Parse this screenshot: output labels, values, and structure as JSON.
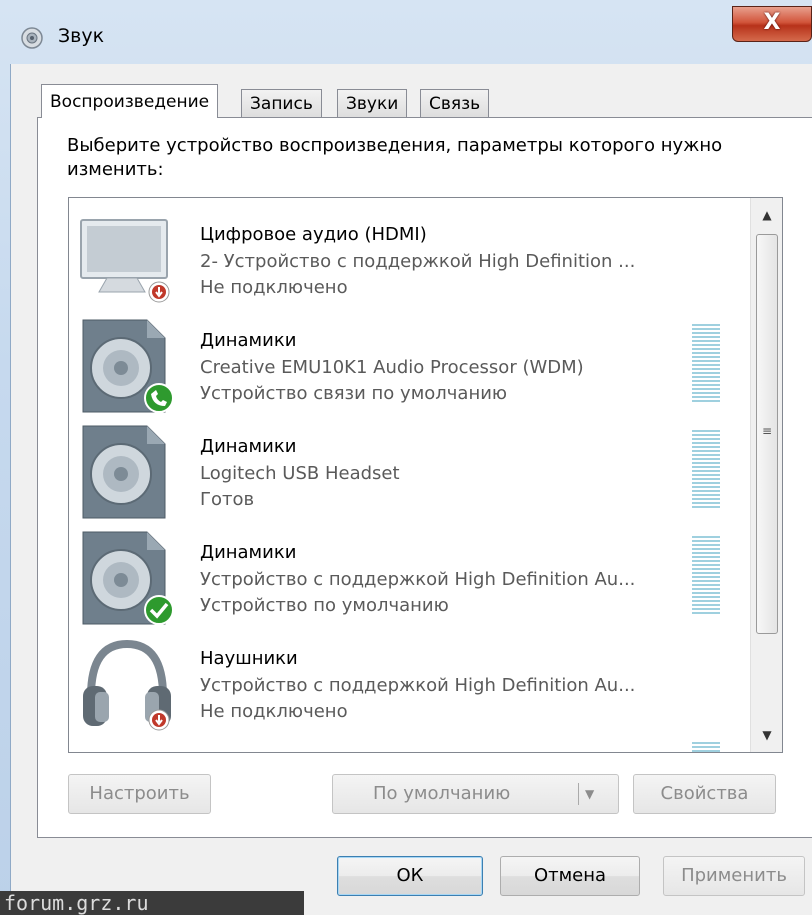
{
  "window": {
    "title": "Звук",
    "close_label": "X"
  },
  "tabs": [
    {
      "label": "Воспроизведение",
      "active": true
    },
    {
      "label": "Запись",
      "active": false
    },
    {
      "label": "Звуки",
      "active": false
    },
    {
      "label": "Связь",
      "active": false
    }
  ],
  "prompt": "Выберите устройство воспроизведения, параметры которого нужно изменить:",
  "devices": [
    {
      "name": "Цифровое аудио (HDMI)",
      "line1": "2- Устройство с поддержкой High Definition ...",
      "line2": "Не подключено",
      "icon": "monitor-icon",
      "badge": "disconnected-badge-icon",
      "level_meter": false
    },
    {
      "name": "Динамики",
      "line1": "Creative EMU10K1 Audio Processor (WDM)",
      "line2": "Устройство связи по умолчанию",
      "icon": "speaker-icon",
      "badge": "communication-default-badge-icon",
      "level_meter": true
    },
    {
      "name": "Динамики",
      "line1": "Logitech USB Headset",
      "line2": "Готов",
      "icon": "speaker-icon",
      "badge": "",
      "level_meter": true
    },
    {
      "name": "Динамики",
      "line1": "Устройство с поддержкой High Definition Au...",
      "line2": "Устройство по умолчанию",
      "icon": "speaker-icon",
      "badge": "default-check-badge-icon",
      "level_meter": true
    },
    {
      "name": "Наушники",
      "line1": "Устройство с поддержкой High Definition Au...",
      "line2": "Не подключено",
      "icon": "headphones-icon",
      "badge": "disconnected-badge-icon",
      "level_meter": false
    }
  ],
  "buttons": {
    "configure": "Настроить",
    "set_default": "По умолчанию",
    "properties": "Свойства",
    "ok": "ОК",
    "cancel": "Отмена",
    "apply": "Применить"
  },
  "watermark": "forum.grz.ru",
  "colors": {
    "close_button": "#c4412a",
    "meter": "#9fd0df",
    "connected_badge": "#2e9a2e",
    "disconnected_badge": "#c0392b"
  }
}
